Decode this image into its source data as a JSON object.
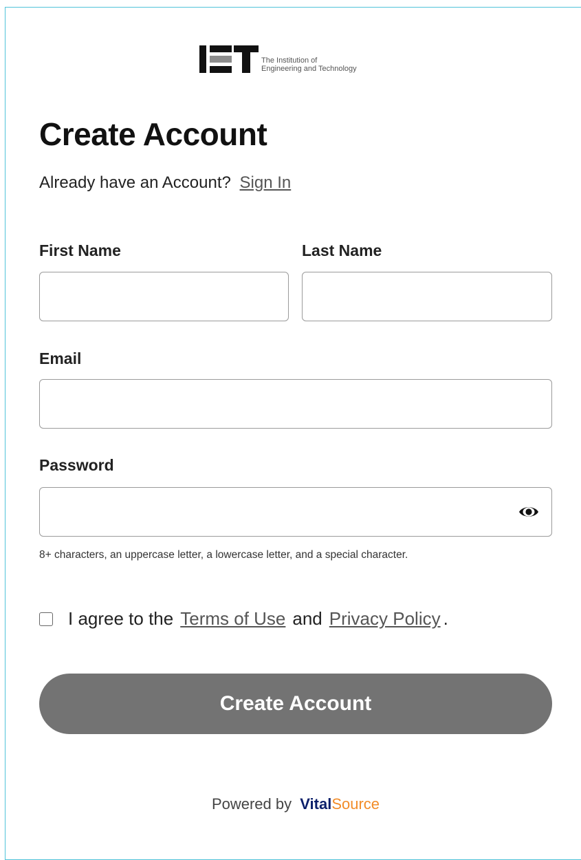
{
  "logo": {
    "line1": "The Institution of",
    "line2": "Engineering and Technology"
  },
  "page": {
    "title": "Create Account",
    "signin_prompt": "Already have an Account?",
    "signin_link": "Sign In"
  },
  "form": {
    "first_name_label": "First Name",
    "first_name_value": "",
    "last_name_label": "Last Name",
    "last_name_value": "",
    "email_label": "Email",
    "email_value": "",
    "password_label": "Password",
    "password_value": "",
    "password_hint": "8+ characters, an uppercase letter, a lowercase letter, and a special character.",
    "agree_prefix": "I agree to the",
    "terms_link": "Terms of Use",
    "agree_and": "and",
    "privacy_link": "Privacy Policy",
    "agree_suffix": ".",
    "agree_checked": false,
    "submit_label": "Create Account"
  },
  "footer": {
    "powered_by": "Powered by",
    "brand_vital": "Vital",
    "brand_source": "Source"
  },
  "colors": {
    "frame_border": "#4fc3d9",
    "button_bg": "#737373",
    "brand_blue": "#0b1f6a",
    "brand_orange": "#f28c28"
  }
}
